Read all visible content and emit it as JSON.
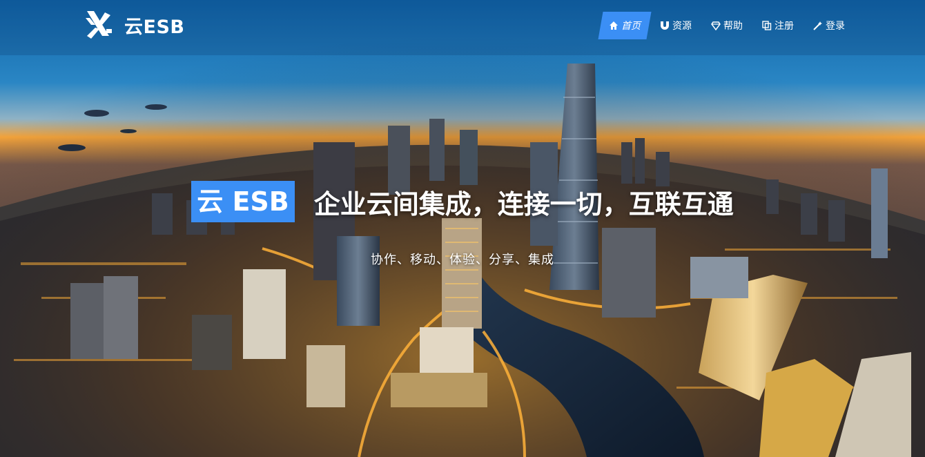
{
  "brand": {
    "name": "云ESB",
    "logo_icon": "esb-cross-icon"
  },
  "nav": {
    "items": [
      {
        "label": "首页",
        "icon": "home-icon",
        "active": true
      },
      {
        "label": "资源",
        "icon": "magnet-icon",
        "active": false
      },
      {
        "label": "帮助",
        "icon": "diamond-icon",
        "active": false
      },
      {
        "label": "注册",
        "icon": "copy-icon",
        "active": false
      },
      {
        "label": "登录",
        "icon": "magic-wand-icon",
        "active": false
      }
    ]
  },
  "hero": {
    "badge": "云 ESB",
    "headline": "企业云间集成，连接一切，互联互通",
    "subline": "协作、移动、体验、分享、集成"
  },
  "colors": {
    "accent": "#3b8ff5",
    "text": "#ffffff"
  }
}
